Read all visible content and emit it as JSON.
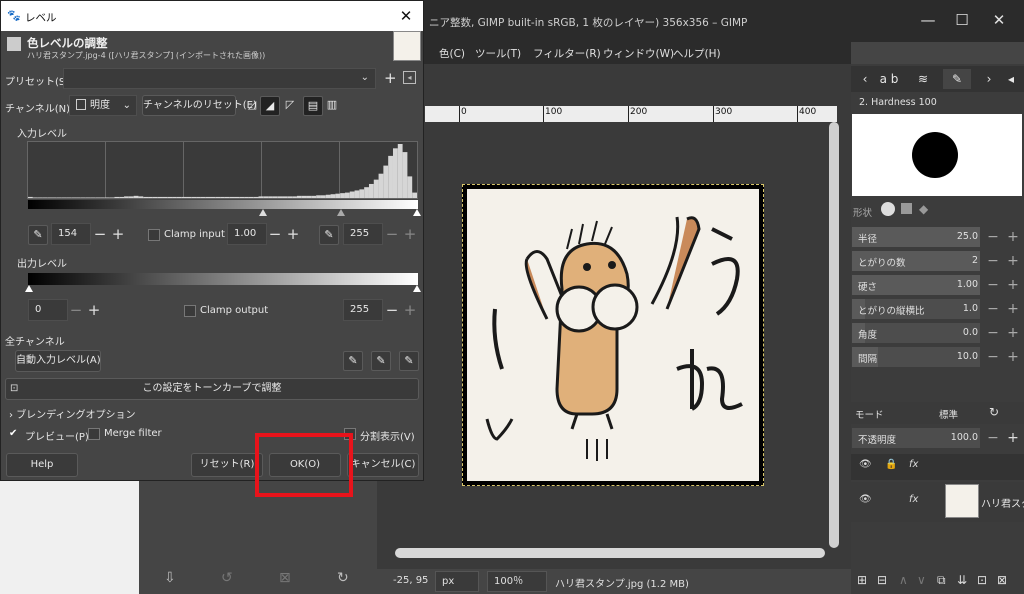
{
  "gimp": {
    "title": "ニア整数, GIMP built-in sRGB, 1 枚のレイヤー) 356x356 – GIMP",
    "window_controls": [
      "—",
      "☐",
      "✕"
    ],
    "menu": [
      "色(C)",
      "ツール(T)",
      "フィルター(R)",
      "ウィンドウ(W)",
      "ヘルプ(H)"
    ],
    "canvas_tab_icon": "⊠",
    "ruler": [
      "0",
      "100",
      "200",
      "300",
      "400"
    ],
    "status": {
      "coords": "-25, 95",
      "unit": "px",
      "zoom": "100％",
      "file": "ハリ君スタンプ.jpg (1.2 MB)"
    }
  },
  "dock": {
    "brush_name": "2. Hardness 100",
    "shape_label": "形状",
    "params": [
      {
        "label": "半径",
        "value": "25.0",
        "fill": 1.0
      },
      {
        "label": "とがりの数",
        "value": "2",
        "fill": 1.0
      },
      {
        "label": "硬さ",
        "value": "1.00",
        "fill": 1.0
      },
      {
        "label": "とがりの縦横比",
        "value": "1.0",
        "fill": 0.1
      },
      {
        "label": "角度",
        "value": "0.0",
        "fill": 0.1
      },
      {
        "label": "間隔",
        "value": "10.0",
        "fill": 0.2
      }
    ],
    "mode_label": "モード",
    "mode_value": "標準",
    "opacity_label": "不透明度",
    "opacity_value": "100.0",
    "layer_name": "ハリ君スタ"
  },
  "dialog": {
    "title": "レベル",
    "heading": "色レベルの調整",
    "subtitle": "ハリ君スタンプ.jpg-4 ([ハリ君スタンプ] (インポートされた画像))",
    "preset_label": "プリセット(S):",
    "channel_label": "チャンネル(N):",
    "channel_value": "明度",
    "reset_channel": "チャンネルのリセット(E)",
    "input_levels_label": "入力レベル",
    "input_low": "154",
    "clamp_input": "Clamp input",
    "gamma": "1.00",
    "input_high": "255",
    "output_levels_label": "出力レベル",
    "output_low": "0",
    "clamp_output": "Clamp output",
    "output_high": "255",
    "all_channels_label": "全チャンネル",
    "auto_button": "自動入力レベル(A)",
    "curves_button": "この設定をトーンカーブで調整",
    "blending": "ブレンディングオプション",
    "preview": "プレビュー(P)",
    "merge_filter": "Merge filter",
    "split_view": "分割表示(V)",
    "help": "Help",
    "reset": "リセット(R)",
    "ok": "OK(O)",
    "cancel": "キャンセル(C)"
  },
  "chart_data": {
    "type": "histogram",
    "note_values": [
      2,
      1,
      1,
      1,
      1,
      1,
      1,
      1,
      1,
      1,
      1,
      1,
      1,
      1,
      1,
      1,
      1,
      1,
      2,
      2,
      3,
      3,
      4,
      3,
      2,
      2,
      2,
      2,
      2,
      2,
      2,
      2,
      2,
      2,
      2,
      2,
      2,
      2,
      2,
      2,
      2,
      2,
      2,
      2,
      2,
      2,
      2,
      2,
      3,
      3,
      3,
      3,
      3,
      3,
      3,
      3,
      4,
      4,
      4,
      4,
      5,
      5,
      6,
      7,
      8,
      9,
      10,
      12,
      14,
      16,
      20,
      26,
      34,
      45,
      60,
      78,
      92,
      100,
      85,
      40,
      10
    ],
    "input_range": [
      154,
      255
    ]
  }
}
